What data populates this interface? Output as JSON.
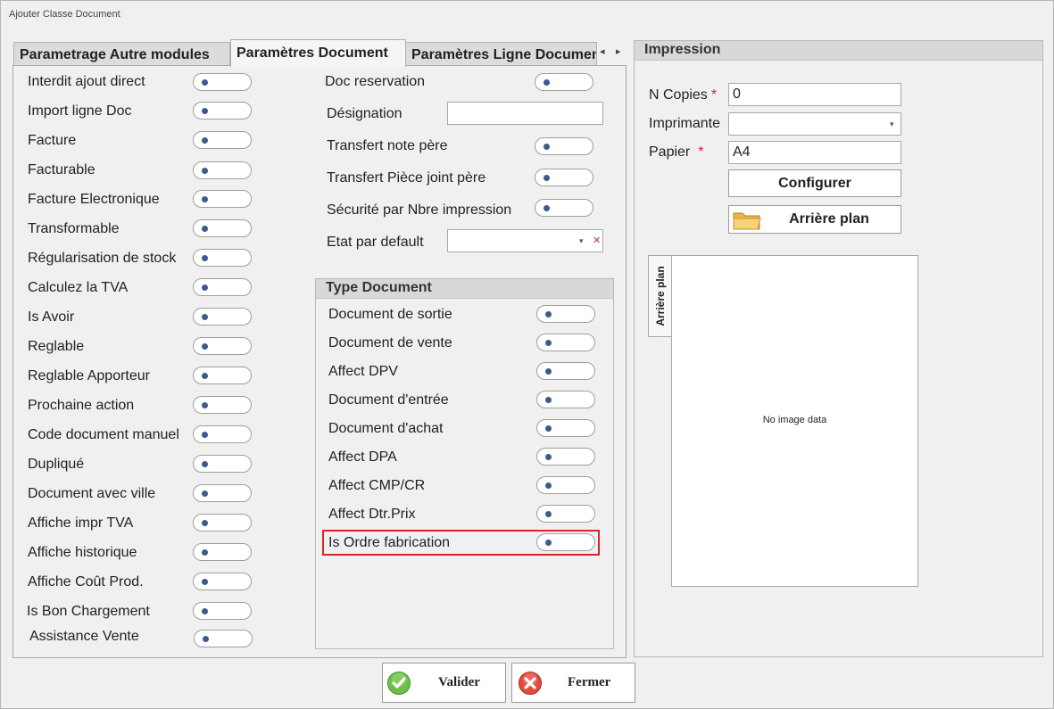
{
  "window": {
    "title": "Ajouter Classe Document"
  },
  "tabs": [
    "Parametrage Autre modules",
    "Paramètres Document",
    "Paramètres Ligne Document"
  ],
  "tab_nav": {
    "prev": "◂",
    "next": "▸"
  },
  "left_column": [
    "Interdit ajout direct",
    "Import ligne Doc",
    "Facture",
    "Facturable",
    "Facture Electronique",
    "Transformable",
    "Régularisation de stock",
    "Calculez la TVA",
    "Is Avoir",
    "Reglable",
    "Reglable Apporteur",
    "Prochaine action",
    "Code document manuel",
    "Dupliqué",
    "Document avec ville",
    "Affiche impr TVA",
    "Affiche historique",
    "Affiche Coût Prod.",
    "Is Bon Chargement",
    "Assistance Vente"
  ],
  "right_column": {
    "doc_reservation": "Doc reservation",
    "designation": "Désignation",
    "designation_value": "",
    "transfert_note": "Transfert note père",
    "transfert_piece": "Transfert Pièce joint père",
    "securite": "Sécurité par Nbre impression",
    "etat_par_default": "Etat par default",
    "etat_value": ""
  },
  "type_document": {
    "header": "Type Document",
    "items": [
      "Document de sortie",
      "Document de vente",
      "Affect DPV",
      "Document d'entrée",
      "Document d'achat",
      "Affect DPA",
      "Affect CMP/CR",
      "Affect Dtr.Prix",
      "Is Ordre fabrication"
    ]
  },
  "impression": {
    "header": "Impression",
    "n_copies_label": "N Copies",
    "n_copies_value": "0",
    "imprimante_label": "Imprimante",
    "imprimante_value": "",
    "papier_label": "Papier",
    "papier_value": "A4",
    "required_mark": "*",
    "configurer": "Configurer",
    "arriere_plan_button": "Arrière plan",
    "arriere_plan_tab": "Arrière plan",
    "no_image": "No image data"
  },
  "footer": {
    "valider": "Valider",
    "fermer": "Fermer"
  },
  "colors": {
    "highlight": "#d9232d",
    "knob": "#3c5a8c",
    "required": "#d9232d"
  }
}
